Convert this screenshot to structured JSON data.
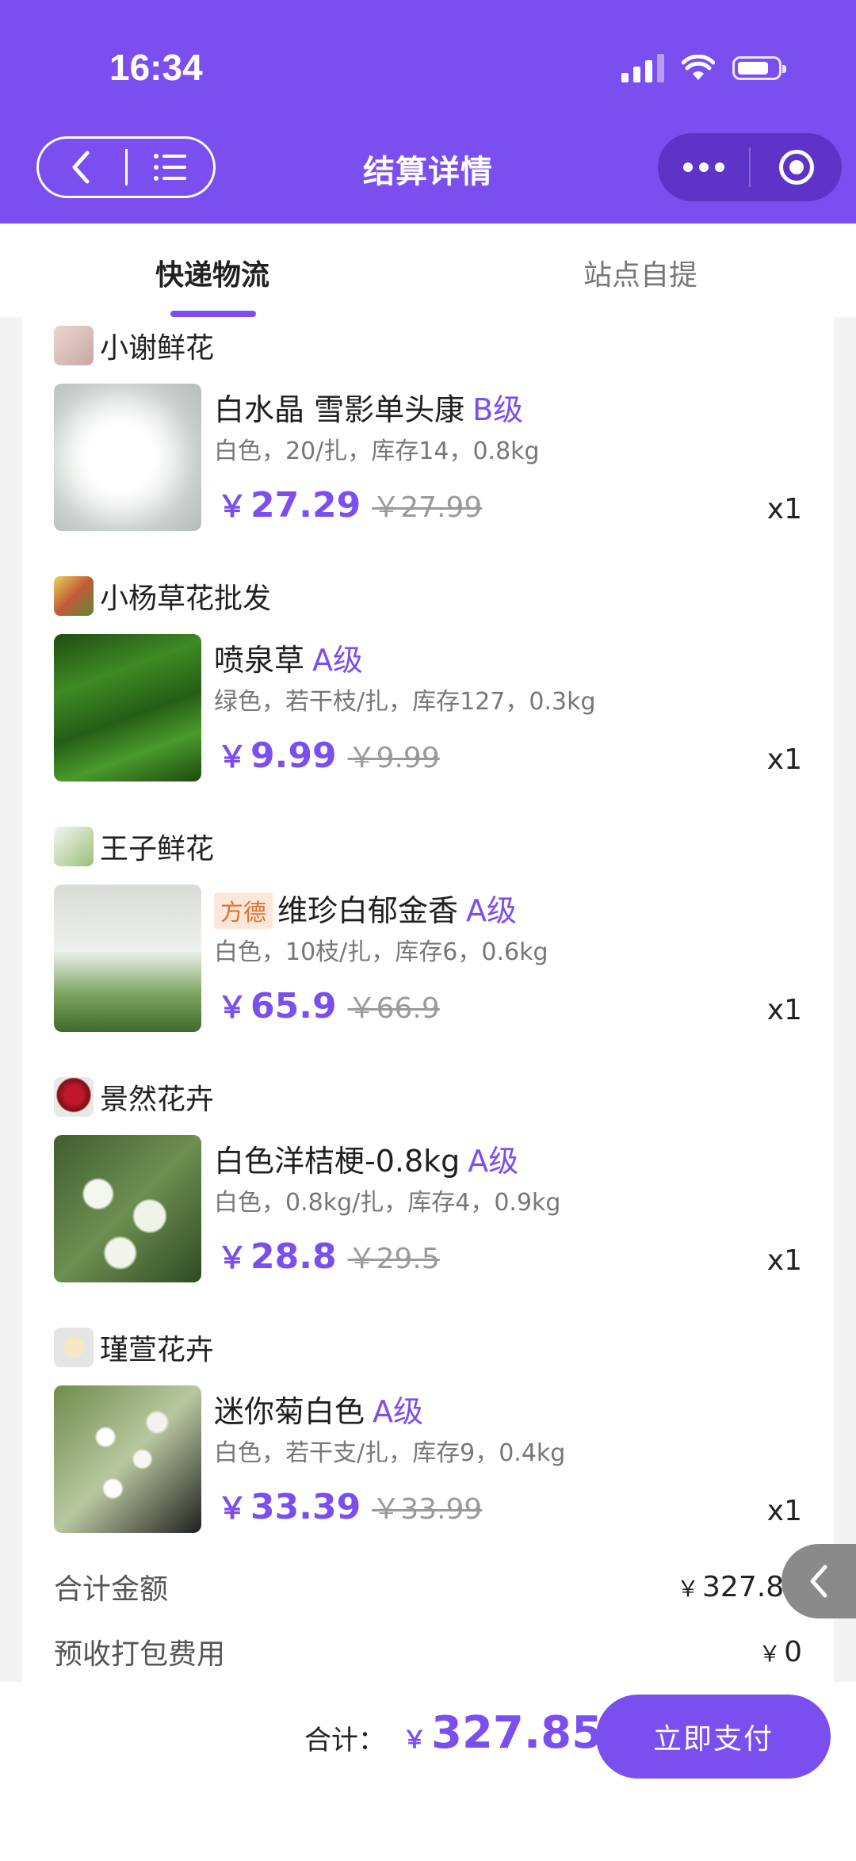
{
  "status_bar": {
    "time": "16:34"
  },
  "nav": {
    "title": "结算详情"
  },
  "tabs": [
    {
      "label": "快递物流",
      "active": true
    },
    {
      "label": "站点自提",
      "active": false
    }
  ],
  "orders": [
    {
      "shop": "小谢鲜花",
      "item": {
        "title": "白水晶 雪影单头康",
        "grade": "B级",
        "tag": "",
        "spec": "白色，20/扎，库存14，0.8kg",
        "price": "27.29",
        "old_price": "￥27.99",
        "qty": "x1"
      }
    },
    {
      "shop": "小杨草花批发",
      "item": {
        "title": "喷泉草",
        "grade": "A级",
        "tag": "",
        "spec": "绿色，若干枝/扎，库存127，0.3kg",
        "price": "9.99",
        "old_price": "￥9.99",
        "qty": "x1"
      }
    },
    {
      "shop": "王子鲜花",
      "item": {
        "title": "维珍白郁金香",
        "grade": "A级",
        "tag": "方德",
        "spec": "白色，10枝/扎，库存6，0.6kg",
        "price": "65.9",
        "old_price": "￥66.9",
        "qty": "x1"
      }
    },
    {
      "shop": "景然花卉",
      "item": {
        "title": "白色洋桔梗-0.8kg",
        "grade": "A级",
        "tag": "",
        "spec": "白色，0.8kg/扎，库存4，0.9kg",
        "price": "28.8",
        "old_price": "￥29.5",
        "qty": "x1"
      }
    },
    {
      "shop": "瑾萱花卉",
      "item": {
        "title": "迷你菊白色",
        "grade": "A级",
        "tag": "",
        "spec": "白色，若干支/扎，库存9，0.4kg",
        "price": "33.39",
        "old_price": "￥33.99",
        "qty": "x1"
      }
    }
  ],
  "currency_symbol": "￥",
  "summary": {
    "subtotal_label": "合计金额",
    "subtotal_value": "327.85",
    "packing_label": "预收打包费用",
    "packing_value": "0"
  },
  "bottom": {
    "total_label": "合计：",
    "total_value": "327.85",
    "pay_label": "立即支付"
  },
  "colors": {
    "brand": "#7b4ef0"
  }
}
